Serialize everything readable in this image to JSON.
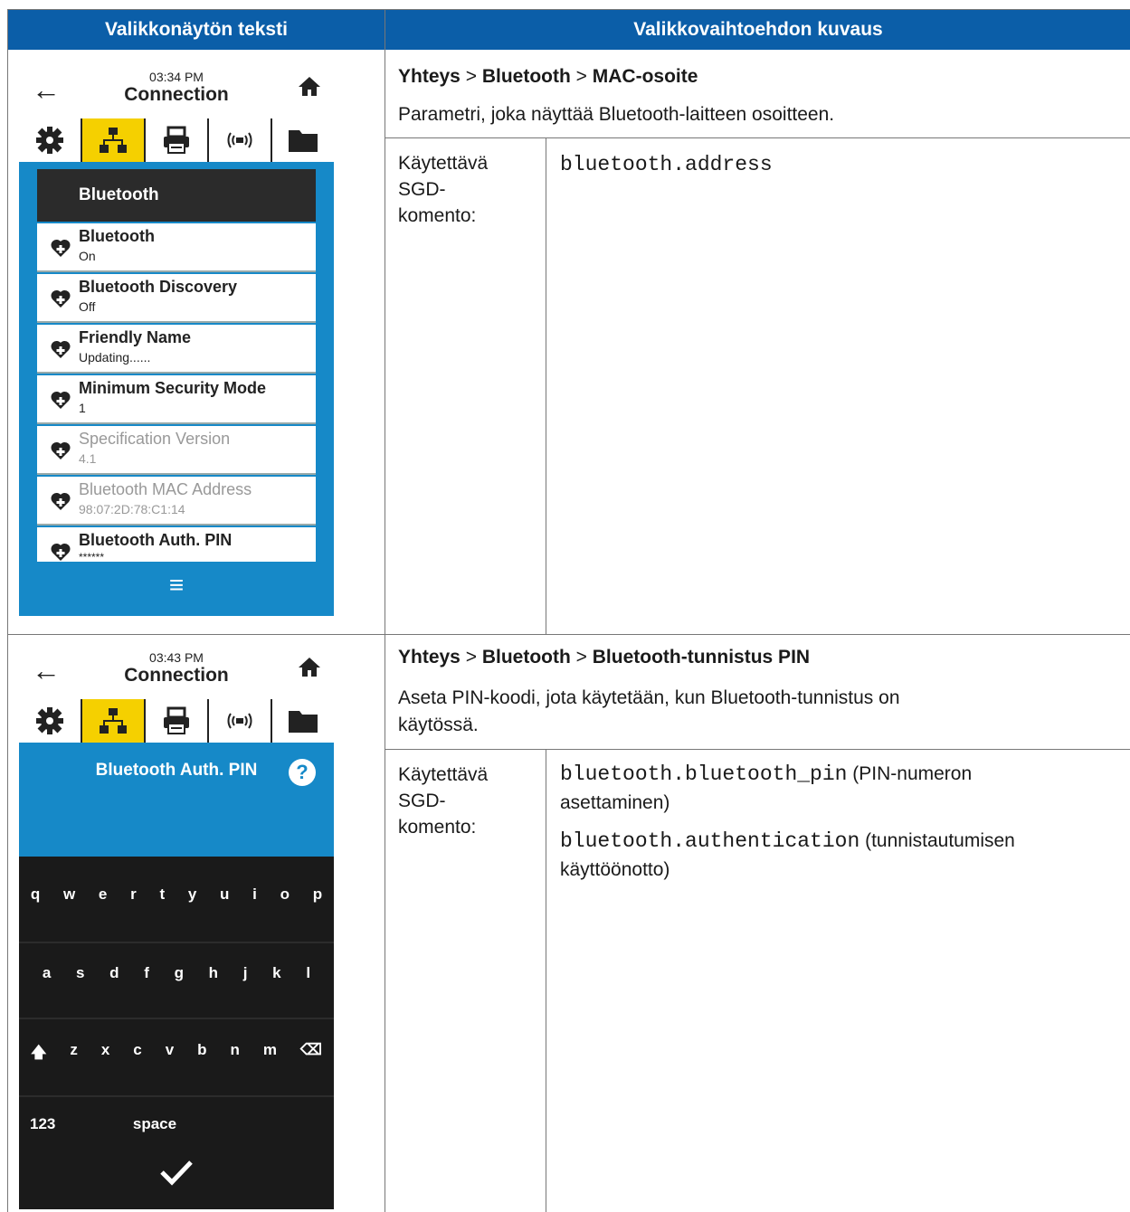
{
  "table": {
    "col1_header": "Valikkonäytön teksti",
    "col2_header": "Valikkovaihtoehdon kuvaus"
  },
  "rows": [
    {
      "path": {
        "a": "Yhteys",
        "b": "Bluetooth",
        "c": "MAC-osoite",
        "sep": ">"
      },
      "description": "Parametri, joka näyttää Bluetooth-laitteen osoitteen.",
      "cmd_label": "Käytettävä SGD-komento:",
      "cmd_label_lines": [
        "Käytettävä",
        "SGD-",
        "komento:"
      ],
      "commands": [
        {
          "code": "bluetooth.address",
          "note": ""
        }
      ],
      "screen": {
        "time": "03:34 PM",
        "title": "Connection",
        "list_header": "Bluetooth",
        "items": [
          {
            "name": "Bluetooth",
            "value": "On",
            "dim": false
          },
          {
            "name": "Bluetooth Discovery",
            "value": "Off",
            "dim": false
          },
          {
            "name": "Friendly Name",
            "value": "Updating......",
            "dim": false
          },
          {
            "name": "Minimum Security Mode",
            "value": "1",
            "dim": false
          },
          {
            "name": "Specification Version",
            "value": "4.1",
            "dim": true
          },
          {
            "name": "Bluetooth MAC Address",
            "value": "98:07:2D:78:C1:14",
            "dim": true
          },
          {
            "name": "Bluetooth Auth. PIN",
            "value": "******",
            "dim": false
          }
        ]
      }
    },
    {
      "path": {
        "a": "Yhteys",
        "b": "Bluetooth",
        "c": "Bluetooth-tunnistus PIN",
        "sep": ">"
      },
      "description_lines": [
        "Aseta PIN-koodi, jota käytetään, kun Bluetooth-tunnistus on",
        "käytössä."
      ],
      "cmd_label_lines": [
        "Käytettävä",
        "SGD-",
        "komento:"
      ],
      "commands": [
        {
          "code": "bluetooth.bluetooth_pin",
          "note": " (PIN-numeron",
          "note2": "asettaminen)"
        },
        {
          "code": "bluetooth.authentication",
          "note": " (tunnistautumisen",
          "note2": "käyttöönotto)"
        }
      ],
      "screen": {
        "time": "03:43 PM",
        "title": "Connection",
        "keyboard_title": "Bluetooth Auth. PIN",
        "help": "?",
        "row1": [
          "q",
          "w",
          "e",
          "r",
          "t",
          "y",
          "u",
          "i",
          "o",
          "p"
        ],
        "row2": [
          "a",
          "s",
          "d",
          "f",
          "g",
          "h",
          "j",
          "k",
          "l"
        ],
        "row3": [
          "z",
          "x",
          "c",
          "v",
          "b",
          "n",
          "m"
        ],
        "num_key": "123",
        "space_key": "space"
      }
    }
  ],
  "icons": {
    "back": "arrow-left-icon",
    "home": "home-icon",
    "tabs": [
      "gear-icon",
      "network-icon",
      "printer-icon",
      "wireless-icon",
      "folder-icon"
    ],
    "item": "heart-plus-icon",
    "menu": "hamburger-icon",
    "confirm": "checkmark-icon"
  },
  "colors": {
    "header_blue": "#0b5ea8",
    "screen_blue": "#1689c8",
    "tab_selected": "#f5d000"
  }
}
